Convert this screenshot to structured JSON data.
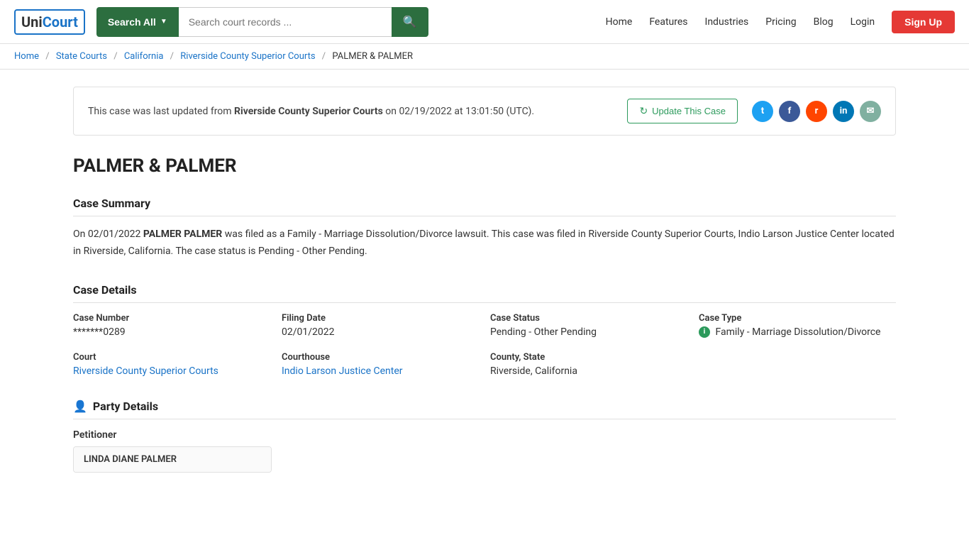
{
  "header": {
    "logo_text": "UniCourt",
    "search_all_label": "Search All",
    "search_placeholder": "Search court records ...",
    "nav": {
      "home": "Home",
      "features": "Features",
      "industries": "Industries",
      "pricing": "Pricing",
      "blog": "Blog",
      "login": "Login",
      "signup": "Sign Up"
    }
  },
  "breadcrumb": {
    "home": "Home",
    "state_courts": "State Courts",
    "california": "California",
    "riverside": "Riverside County Superior Courts",
    "current": "PALMER & PALMER"
  },
  "update_notice": {
    "text_before": "This case was last updated from ",
    "court_name": "Riverside County Superior Courts",
    "text_after": " on 02/19/2022 at 13:01:50 (UTC).",
    "button_label": "Update This Case"
  },
  "case": {
    "title": "PALMER & PALMER",
    "summary_section": "Case Summary",
    "summary_date": "02/01/2022",
    "summary_party": "PALMER PALMER",
    "summary_text": " was filed as a Family - Marriage Dissolution/Divorce lawsuit. This case was filed in Riverside County Superior Courts, Indio Larson Justice Center located in Riverside, California. The case status is Pending - Other Pending.",
    "details_section": "Case Details",
    "case_number_label": "Case Number",
    "case_number_value": "*******0289",
    "filing_date_label": "Filing Date",
    "filing_date_value": "02/01/2022",
    "case_status_label": "Case Status",
    "case_status_value": "Pending - Other Pending",
    "case_type_label": "Case Type",
    "case_type_value": "Family - Marriage Dissolution/Divorce",
    "court_label": "Court",
    "court_value": "Riverside County Superior Courts",
    "courthouse_label": "Courthouse",
    "courthouse_value": "Indio Larson Justice Center",
    "county_state_label": "County, State",
    "county_state_value": "Riverside, California",
    "party_section": "Party Details",
    "petitioner_label": "Petitioner",
    "petitioner_name": "LINDA DIANE PALMER"
  },
  "social": {
    "twitter_title": "Twitter",
    "facebook_title": "Facebook",
    "reddit_title": "Reddit",
    "linkedin_title": "LinkedIn",
    "email_title": "Email"
  }
}
